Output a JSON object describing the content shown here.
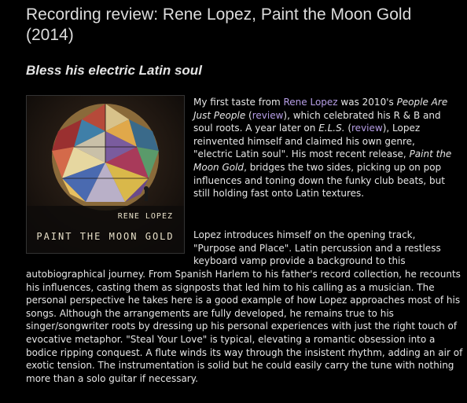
{
  "article": {
    "title": "Recording review: Rene Lopez, Paint the Moon Gold (2014)",
    "subtitle": "Bless his electric Latin soul"
  },
  "cover": {
    "artist": "RENE LOPEZ",
    "album": "PAINT THE MOON GOLD"
  },
  "p1": {
    "t1": "My first taste from ",
    "link_artist": "Rene Lopez",
    "t2": " was 2010's ",
    "album1": "People Are Just People",
    "t3": " (",
    "link_review1": "review",
    "t4": "), which celebrated his R & B and soul roots. A year later on ",
    "album2": "E.L.S.",
    "t5": " (",
    "link_review2": "review",
    "t6": "), Lopez reinvented himself and claimed his own genre, \"electric Latin soul\".  His most recent release, ",
    "album3": "Paint the Moon Gold",
    "t7": ", bridges the two sides, picking up on pop influences and toning down the funky club beats, but still holding fast onto Latin textures."
  },
  "p2": {
    "part1": "Lopez introduces himself on the opening track, \"Purpose and Place\". Latin percussion and a restless keyboard vamp provide a background to this",
    "part2": "autobiographical journey. From Spanish Harlem to his father's record collection, he recounts his influences, casting them as signposts that led him to his calling as a musician. The personal perspective he takes here is a good example of how Lopez approaches most of his songs. Although the arrangements are fully developed, he remains true to his singer/songwriter roots by dressing up his personal experiences with just the right touch of evocative metaphor. \"Steal Your Love\" is typical, elevating a romantic obsession into a bodice ripping conquest. A flute winds its way through the insistent rhythm, adding an air of exotic tension. The instrumentation is solid but he could easily carry the tune with nothing more than a solo guitar if necessary."
  },
  "colors": {
    "background": "#000000",
    "text": "#e6e6e6",
    "link": "#b69ee6"
  }
}
